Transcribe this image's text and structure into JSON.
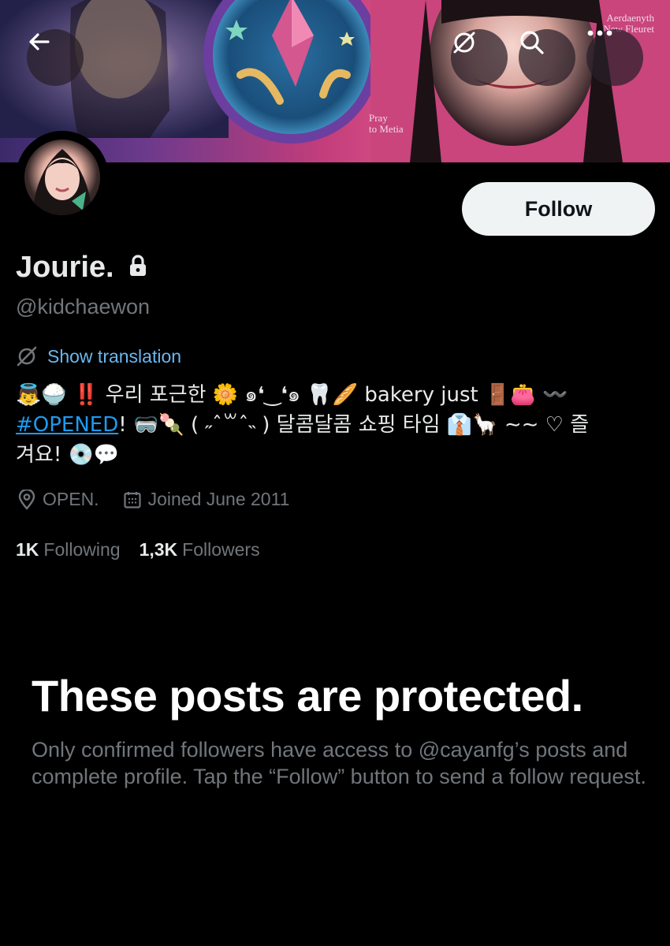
{
  "header": {
    "banner_text": [
      "Aerdaenyth",
      "New Fleuret"
    ],
    "banner_caption": [
      "Pray",
      "to Metia"
    ],
    "back_icon": "arrow-left-icon",
    "translate_icon": "translate-off-icon",
    "search_icon": "search-icon",
    "more_icon": "more-dots-icon"
  },
  "profile": {
    "name": "Jourie.",
    "handle": "@kidchaewon",
    "follow_label": "Follow",
    "show_translation": "Show translation",
    "bio": {
      "line1": "👼🍚 ‼️ 우리 포근한 🌼 ๑❛‿❛๑ 🦷🥖 bakery just 🚪👛 〰️",
      "hashtag": "#OPENED",
      "line2_rest": "! 🥽🍡 ( ˶ˆ꒳ˆ˵ ) 달콤달콤 쇼핑 타임 👔🦙 ∼∼ ♡ 즐",
      "line3": "겨요! 💿💬"
    },
    "location": "OPEN.",
    "joined": "Joined June 2011",
    "following_count": "1K",
    "following_label": "Following",
    "followers_count": "1,3K",
    "followers_label": "Followers"
  },
  "protected": {
    "title": "These posts are protected.",
    "body": "Only confirmed followers have access to @cayanfg’s posts and complete profile. Tap the “Follow” button to send a follow request."
  },
  "colors": {
    "background": "#000000",
    "link": "#1d9bf0",
    "secondary_text": "#71767b",
    "follow_button_bg": "#eff3f4"
  }
}
